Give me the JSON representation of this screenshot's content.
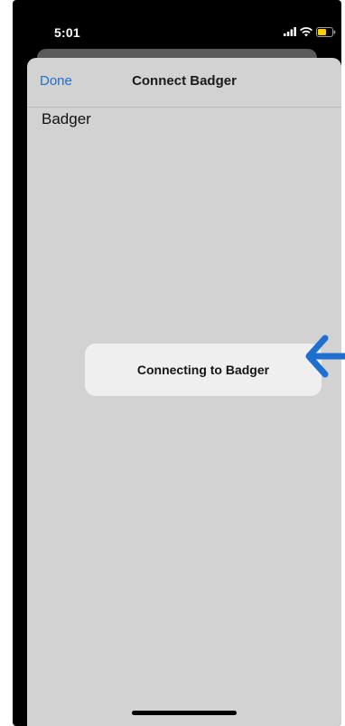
{
  "status_bar": {
    "time": "5:01",
    "icons": [
      "cellular-signal-icon",
      "wifi-icon",
      "battery-icon"
    ],
    "battery_color": "#f5d000"
  },
  "sheet": {
    "nav": {
      "done_label": "Done",
      "title": "Connect Badger"
    },
    "items": [
      {
        "label": "Badger"
      }
    ]
  },
  "toast": {
    "message": "Connecting to Badger"
  },
  "annotation": {
    "arrow_color": "#1f6fd1"
  },
  "colors": {
    "accent": "#1f6fd1",
    "sheet_background": "#d2d2d2",
    "toast_background": "#efefef"
  }
}
